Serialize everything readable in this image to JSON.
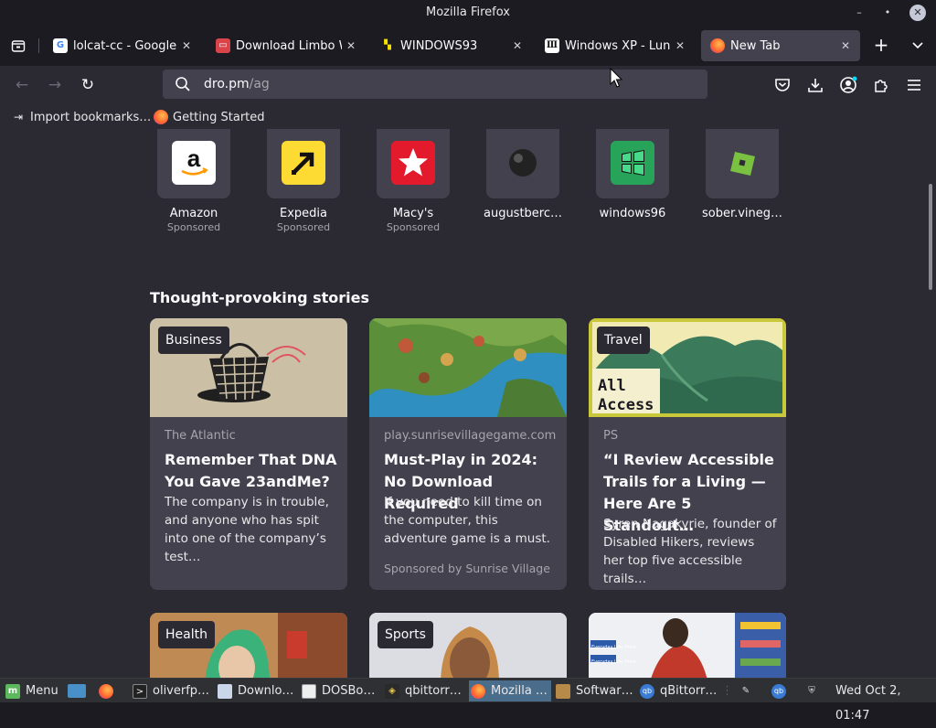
{
  "window": {
    "title": "Mozilla Firefox"
  },
  "tabs": [
    {
      "title": "lolcat-cc - Google Se",
      "favicon": "google-icon"
    },
    {
      "title": "Download Limbo Wi",
      "favicon": "limbo-icon"
    },
    {
      "title": "WINDOWS93",
      "favicon": "windows93-icon"
    },
    {
      "title": "Windows XP - Luna T",
      "favicon": "wikipedia-icon"
    },
    {
      "title": "New Tab",
      "favicon": "firefox-icon",
      "selected": true
    }
  ],
  "navbar": {
    "url_host": "dro.pm",
    "url_path": "/ag"
  },
  "bookmarks": [
    {
      "label": "Import bookmarks…",
      "icon": "import-icon"
    },
    {
      "label": "Getting Started",
      "icon": "firefox-icon"
    }
  ],
  "top_sites": [
    {
      "name": "Amazon",
      "sponsored": "Sponsored"
    },
    {
      "name": "Expedia",
      "sponsored": "Sponsored"
    },
    {
      "name": "Macy's",
      "sponsored": "Sponsored"
    },
    {
      "name": "augustberc…",
      "sponsored": ""
    },
    {
      "name": "windows96",
      "sponsored": ""
    },
    {
      "name": "sober.vineg…",
      "sponsored": ""
    }
  ],
  "stories": {
    "heading": "Thought-provoking stories",
    "cards": [
      {
        "badge": "Business",
        "publisher": "The Atlantic",
        "headline": "Remember That DNA You Gave 23andMe?",
        "excerpt": "The company is in trouble, and anyone who has spit into one of the company’s test…",
        "sponsor": ""
      },
      {
        "badge": "",
        "publisher": "play.sunrisevillagegame.com",
        "headline": "Must-Play in 2024: No Download Required",
        "excerpt": "If you need to kill time on the computer, this adventure game is a must.",
        "sponsor": "Sponsored by Sunrise Village"
      },
      {
        "badge": "Travel",
        "publisher": "PS",
        "headline": "“I Review Accessible Trails for a Living — Here Are 5 Standout…",
        "excerpt": "Syren Nagakyrie, founder of Disabled Hikers, reviews her top five accessible trails…",
        "sponsor": "",
        "image_text_1": "All",
        "image_text_2": "Access"
      },
      {
        "badge": "Health"
      },
      {
        "badge": "Sports"
      },
      {
        "badge": "",
        "image_text_1": "Everyday Low Price",
        "image_text_2": "Everyday Low Price"
      }
    ]
  },
  "taskbar": {
    "menu_label": "Menu",
    "items": [
      {
        "label": "oliverfp…",
        "icon": "terminal-icon"
      },
      {
        "label": "Downlo…",
        "icon": "folder-icon"
      },
      {
        "label": "DOSBo…",
        "icon": "dosbox-icon"
      },
      {
        "label": "qbittorr…",
        "icon": "qbittorrent-icon"
      },
      {
        "label": "Mozilla …",
        "icon": "firefox-icon",
        "active": true
      },
      {
        "label": "Softwar…",
        "icon": "package-icon"
      },
      {
        "label": "qBittorr…",
        "icon": "qbittorrent-icon"
      }
    ],
    "clock": "Wed Oct  2, 01:47"
  }
}
